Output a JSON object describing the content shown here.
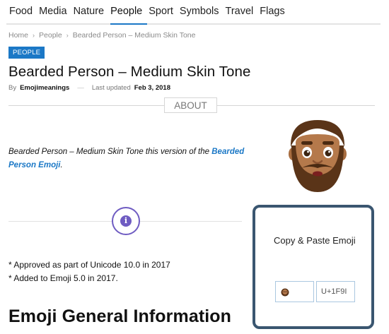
{
  "nav": {
    "items": [
      {
        "label": "Food",
        "active": false
      },
      {
        "label": "Media",
        "active": false
      },
      {
        "label": "Nature",
        "active": false
      },
      {
        "label": "People",
        "active": true
      },
      {
        "label": "Sport",
        "active": false
      },
      {
        "label": "Symbols",
        "active": false
      },
      {
        "label": "Travel",
        "active": false
      },
      {
        "label": "Flags",
        "active": false
      }
    ]
  },
  "breadcrumb": {
    "home": "Home",
    "category": "People",
    "current": "Bearded Person – Medium Skin Tone",
    "separator": "›"
  },
  "category_badge": "PEOPLE",
  "article": {
    "title": "Bearded Person – Medium Skin Tone",
    "by_label": "By",
    "author": "Emojimeanings",
    "dash": "—",
    "updated_label": "Last updated",
    "updated_date": "Feb 3, 2018",
    "about_label": "ABOUT",
    "description_prefix": "Bearded Person – Medium Skin Tone this version of the ",
    "description_link": "Bearded Person Emoji",
    "description_suffix": ".",
    "facts": [
      "* Approved as part of Unicode 10.0 in 2017",
      "* Added to Emoji 5.0 in 2017."
    ],
    "section_heading": "Emoji General Information"
  },
  "copy_card": {
    "label": "Copy & Paste Emoji",
    "code_value": "U+1F9I"
  },
  "icons": {
    "info": "info-icon",
    "emoji": "bearded-person-medium-skin-tone"
  },
  "colors": {
    "accent": "#1b78c6",
    "info_purple": "#6f5cc2",
    "card_border": "#3a5670",
    "skin": "#b5794b",
    "beard": "#5a3418"
  }
}
